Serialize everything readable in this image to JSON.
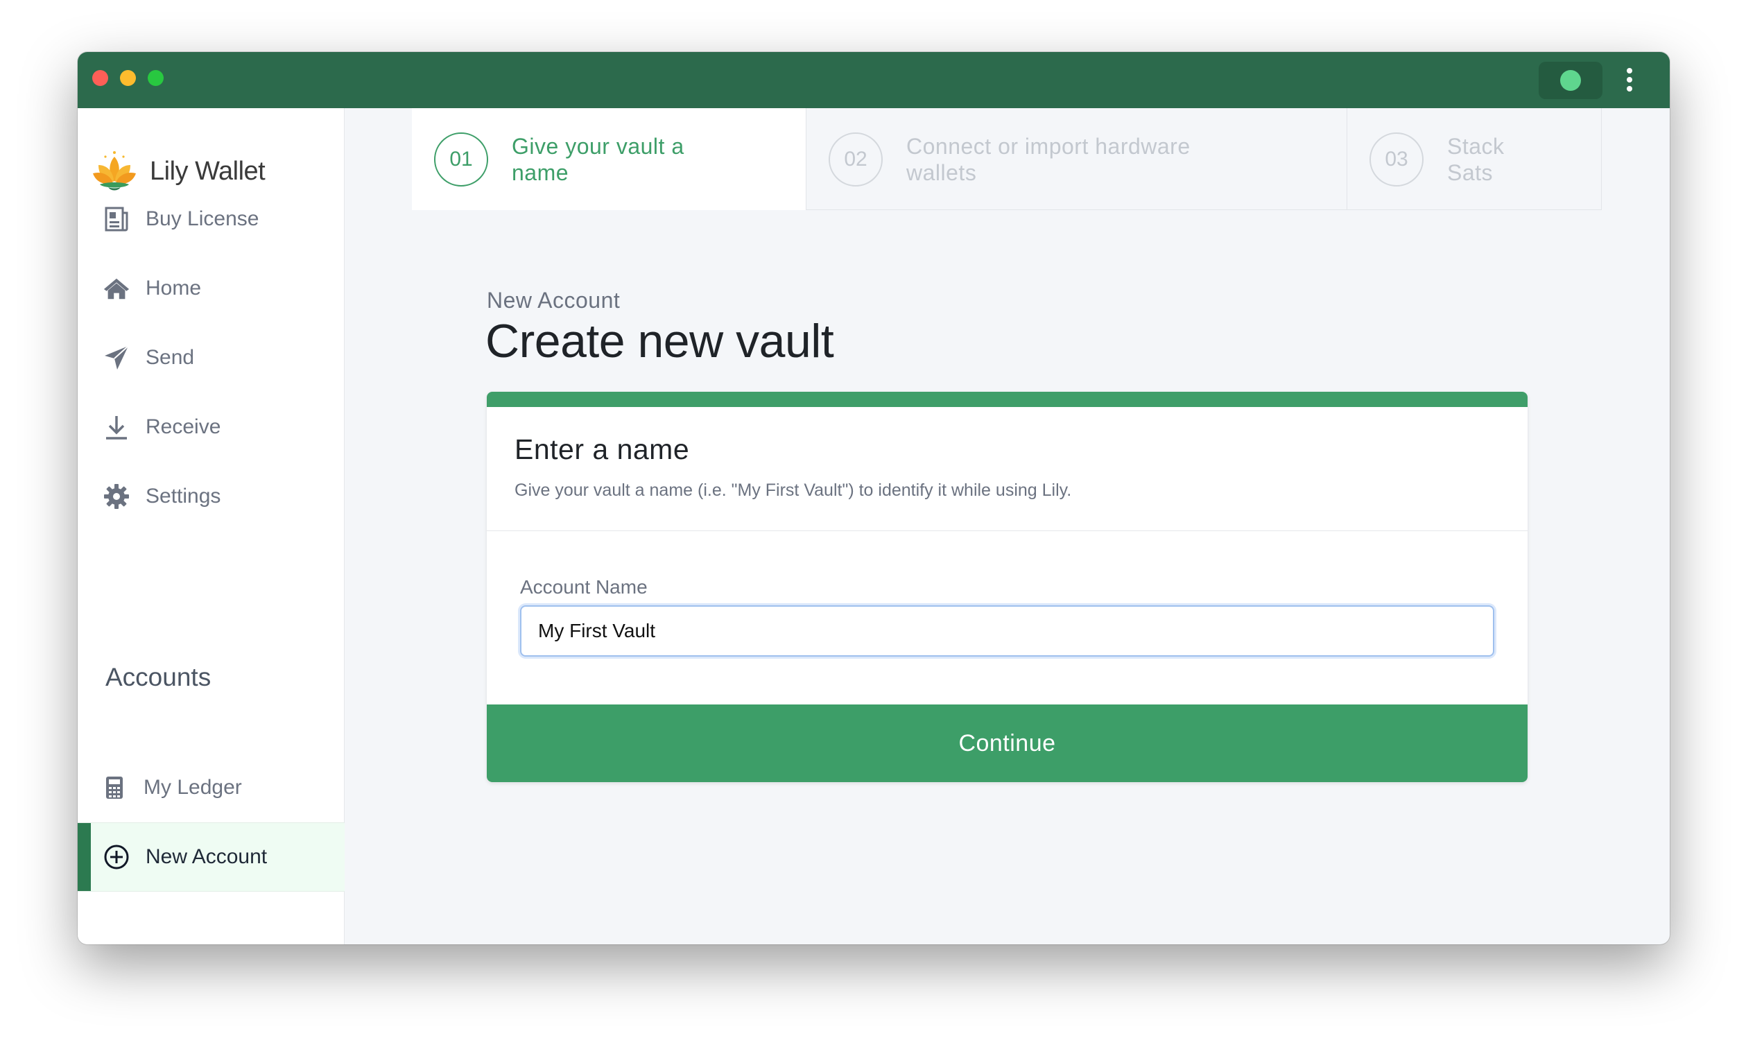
{
  "app": {
    "name": "Lily Wallet",
    "brand_color": "#2c6a4c",
    "accent_color": "#3d9e68",
    "connection_status_color": "#5fd68e"
  },
  "titlebar": {
    "menu_icon": "kebab-menu-icon",
    "status_indicator": "online-dot-icon"
  },
  "sidebar": {
    "items": [
      {
        "label": "Buy License",
        "icon": "receipt-icon"
      },
      {
        "label": "Home",
        "icon": "home-icon"
      },
      {
        "label": "Send",
        "icon": "paper-plane-icon"
      },
      {
        "label": "Receive",
        "icon": "download-icon"
      },
      {
        "label": "Settings",
        "icon": "gear-icon"
      }
    ],
    "accounts_header": "Accounts",
    "accounts": [
      {
        "label": "My Ledger",
        "icon": "calculator-icon"
      },
      {
        "label": "New Account",
        "icon": "plus-circle-icon",
        "active": true
      }
    ]
  },
  "stepper": {
    "steps": [
      {
        "number": "01",
        "label": "Give your vault a name",
        "current": true
      },
      {
        "number": "02",
        "label": "Connect or import hardware wallets",
        "current": false
      },
      {
        "number": "03",
        "label": "Stack Sats",
        "current": false
      }
    ]
  },
  "page": {
    "subtitle": "New Account",
    "title": "Create new vault"
  },
  "form": {
    "title": "Enter a name",
    "description": "Give your vault a name (i.e. \"My First Vault\") to identify it while using Lily.",
    "field_label": "Account Name",
    "field_value": "My First Vault",
    "submit_label": "Continue"
  }
}
